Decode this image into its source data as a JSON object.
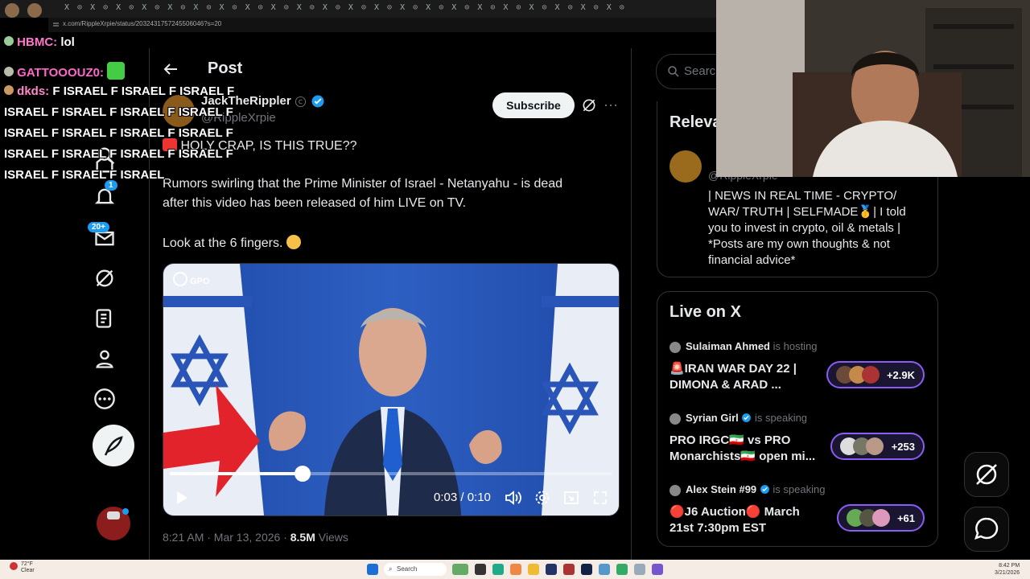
{
  "browser": {
    "url": "x.com/RippleXrpie/status/2032431757245506046?s=20",
    "tab_marks": "X ⊙ X ⊙ X ⊙ X ⊙ X ⊙ X ⊙ X ⊙ X ⊙ X ⊙ X ⊙ X ⊙ X ⊙ X ⊙ X ⊙ X ⊙ X ⊙ X ⊙ X ⊙ X ⊙ X ⊙ X ⊙ X ⊙"
  },
  "chat": [
    {
      "user": "HBMC:",
      "text": "lol",
      "color": "#ff77cc"
    },
    {
      "user": "GATTOOOUZ0:",
      "text": "",
      "color": "#ff66cc"
    },
    {
      "user": "dkds:",
      "text": "F ISRAEL F ISRAEL F ISRAEL F",
      "color": "#ff88cc"
    },
    {
      "user": "",
      "text": "ISRAEL F ISRAEL F ISRAEL F ISRAEL F",
      "color": "#ffffff"
    },
    {
      "user": "",
      "text": "ISRAEL F ISRAEL F ISRAEL F ISRAEL F",
      "color": "#ffffff"
    },
    {
      "user": "",
      "text": "ISRAEL F ISRAEL F ISRAEL F ISRAEL F",
      "color": "#ffffff"
    },
    {
      "user": "",
      "text": "ISRAEL F ISRAEL F ISRAEL",
      "color": "#ffffff"
    }
  ],
  "nav": {
    "notifications_badge": "1",
    "messages_badge": "20+"
  },
  "post": {
    "header_title": "Post",
    "author_name": "JackTheRippler",
    "author_handle": "@RippleXrpie",
    "subscribe_label": "Subscribe",
    "line1": "HOLY CRAP, IS THIS TRUE??",
    "line2": "Rumors swirling that the Prime Minister of Israel - Netanyahu - is dead",
    "line3": "after this video has been released of him LIVE on TV.",
    "line4": "Look at the 6 fingers.",
    "video_logo": "GPO",
    "video_time": "0:03 / 0:10",
    "video_progress": 0.3,
    "time": "8:21 AM · Mar 13, 2026 ·",
    "views_count": "8.5M",
    "views_label": "Views"
  },
  "right": {
    "search_placeholder": "Search",
    "relevant_title": "Relevant people",
    "relevant_handle": "@RippleXrpie",
    "relevant_bio": "| NEWS IN REAL TIME - CRYPTO/ WAR/ TRUTH | SELFMADE🥇| I told you to invest in crypto, oil & metals | *Posts are my own thoughts & not financial advice*",
    "live_title": "Live on X",
    "live": [
      {
        "host": "Sulaiman Ahmed",
        "status": "is hosting",
        "title1": "🚨IRAN WAR DAY 22 |",
        "title2": "DIMONA & ARAD ...",
        "count": "+2.9K"
      },
      {
        "host": "Syrian Girl",
        "status": "is speaking",
        "title1": "PRO IRGC🇮🇷 vs PRO",
        "title2": "Monarchists🇮🇷 open mi...",
        "count": "+253"
      },
      {
        "host": "Alex Stein #99",
        "status": "is speaking",
        "title1": "🔴J6 Auction🔴 March",
        "title2": "21st 7:30pm EST",
        "count": "+61"
      }
    ]
  },
  "taskbar": {
    "weather_temp": "72°F",
    "weather_desc": "Clear",
    "search_label": "Search",
    "clock_time": "8:42 PM",
    "clock_date": "3/21/2026"
  },
  "colors": {
    "accent": "#1d9bf0",
    "live_pill": "#8b5cf6",
    "arrow": "#e3232c"
  }
}
